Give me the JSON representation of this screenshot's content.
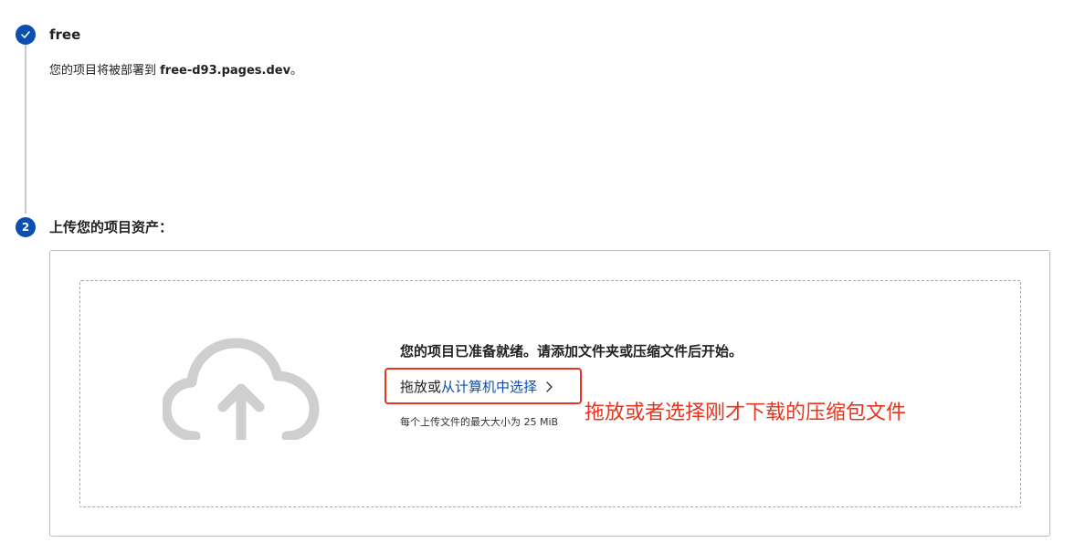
{
  "step1": {
    "title": "free",
    "desc_prefix": "您的项目将被部署到 ",
    "desc_domain": "free-d93.pages.dev",
    "desc_suffix": "。"
  },
  "step2": {
    "number": "2",
    "title": "上传您的项目资产："
  },
  "upload": {
    "ready_text": "您的项目已准备就绪。请添加文件夹或压缩文件后开始。",
    "drag_text": "拖放或",
    "choose_link": "从计算机中选择",
    "max_size_text": "每个上传文件的最大大小为 25 MiB"
  },
  "annotation": {
    "text": "拖放或者选择刚才下载的压缩包文件",
    "color": "#e8341c"
  },
  "colors": {
    "accent": "#0b4fb3",
    "highlight": "#e8341c"
  },
  "icons": {
    "step1": "check-icon",
    "upload": "cloud-upload-icon",
    "link": "chevron-right-icon"
  }
}
